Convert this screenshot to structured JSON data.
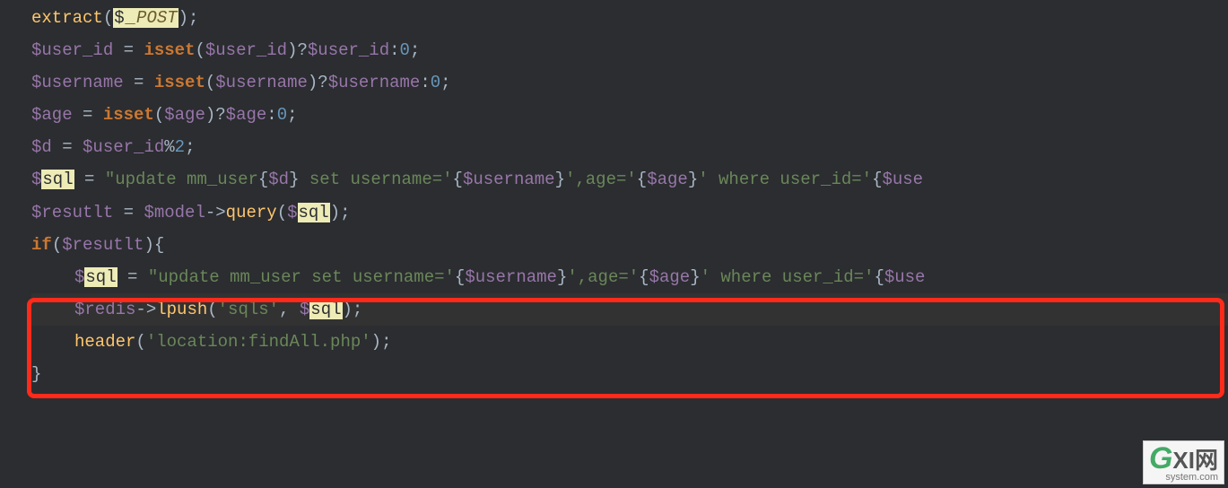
{
  "code": {
    "l1": {
      "fn": "extract",
      "p_open": "(",
      "dollar": "$",
      "const": "_POST",
      "p_close": ");"
    },
    "l2": {
      "var1": "$user_id",
      "eq": " = ",
      "isset": "isset",
      "po": "(",
      "var2": "$user_id",
      "pc": ")?",
      "var3": "$user_id",
      "colon": ":",
      "zero": "0",
      "semi": ";"
    },
    "l3": {
      "var1": "$username",
      "eq": " = ",
      "isset": "isset",
      "po": "(",
      "var2": "$username",
      "pc": ")?",
      "var3": "$username",
      "colon": ":",
      "zero": "0",
      "semi": ";"
    },
    "l4": {
      "var1": "$age",
      "eq": " = ",
      "isset": "isset",
      "po": "(",
      "var2": "$age",
      "pc": ")?",
      "var3": "$age",
      "colon": ":",
      "zero": "0",
      "semi": ";"
    },
    "l5": {
      "var1": "$d",
      "eq": " = ",
      "var2": "$user_id",
      "op": "%",
      "num": "2",
      "semi": ";"
    },
    "l6": {
      "dollar": "$",
      "sql": "sql",
      "eq": " = ",
      "str1": "\"update mm_user",
      "b1o": "{",
      "v1": "$d",
      "b1c": "}",
      "str2": " set username='",
      "b2o": "{",
      "v2": "$username",
      "b2c": "}",
      "str3": "',age='",
      "b3o": "{",
      "v3": "$age",
      "b3c": "}",
      "str4": "' where user_id='",
      "b4o": "{",
      "v4": "$use"
    },
    "l7": {
      "var1": "$resutlt",
      "eq": " = ",
      "var2": "$model",
      "arrow": "->",
      "fn": "query",
      "po": "(",
      "dollar": "$",
      "sql": "sql",
      "pc": ");"
    },
    "l8": {
      "if": "if",
      "po": "(",
      "var": "$resutlt",
      "pc": "){"
    },
    "l9": {
      "dollar": "$",
      "sql": "sql",
      "eq": " = ",
      "str1": "\"update mm_user set username='",
      "b1o": "{",
      "v1": "$username",
      "b1c": "}",
      "str2": "',age='",
      "b2o": "{",
      "v2": "$age",
      "b2c": "}",
      "str3": "' where user_id='",
      "b3o": "{",
      "v3": "$use"
    },
    "l10": {
      "var1": "$redis",
      "arrow": "->",
      "fn": "lpush",
      "po": "(",
      "str": "'sqls'",
      "comma": ", ",
      "dollar": "$",
      "sql": "sql",
      "pc": ");"
    },
    "l11": {
      "fn": "header",
      "po": "(",
      "str": "'location:findAll.php'",
      "pc": ");"
    },
    "l12": {
      "brace": "}"
    }
  },
  "watermark": {
    "g": "G",
    "xi": "XI",
    "cn": "网",
    "sub": "system.com"
  }
}
